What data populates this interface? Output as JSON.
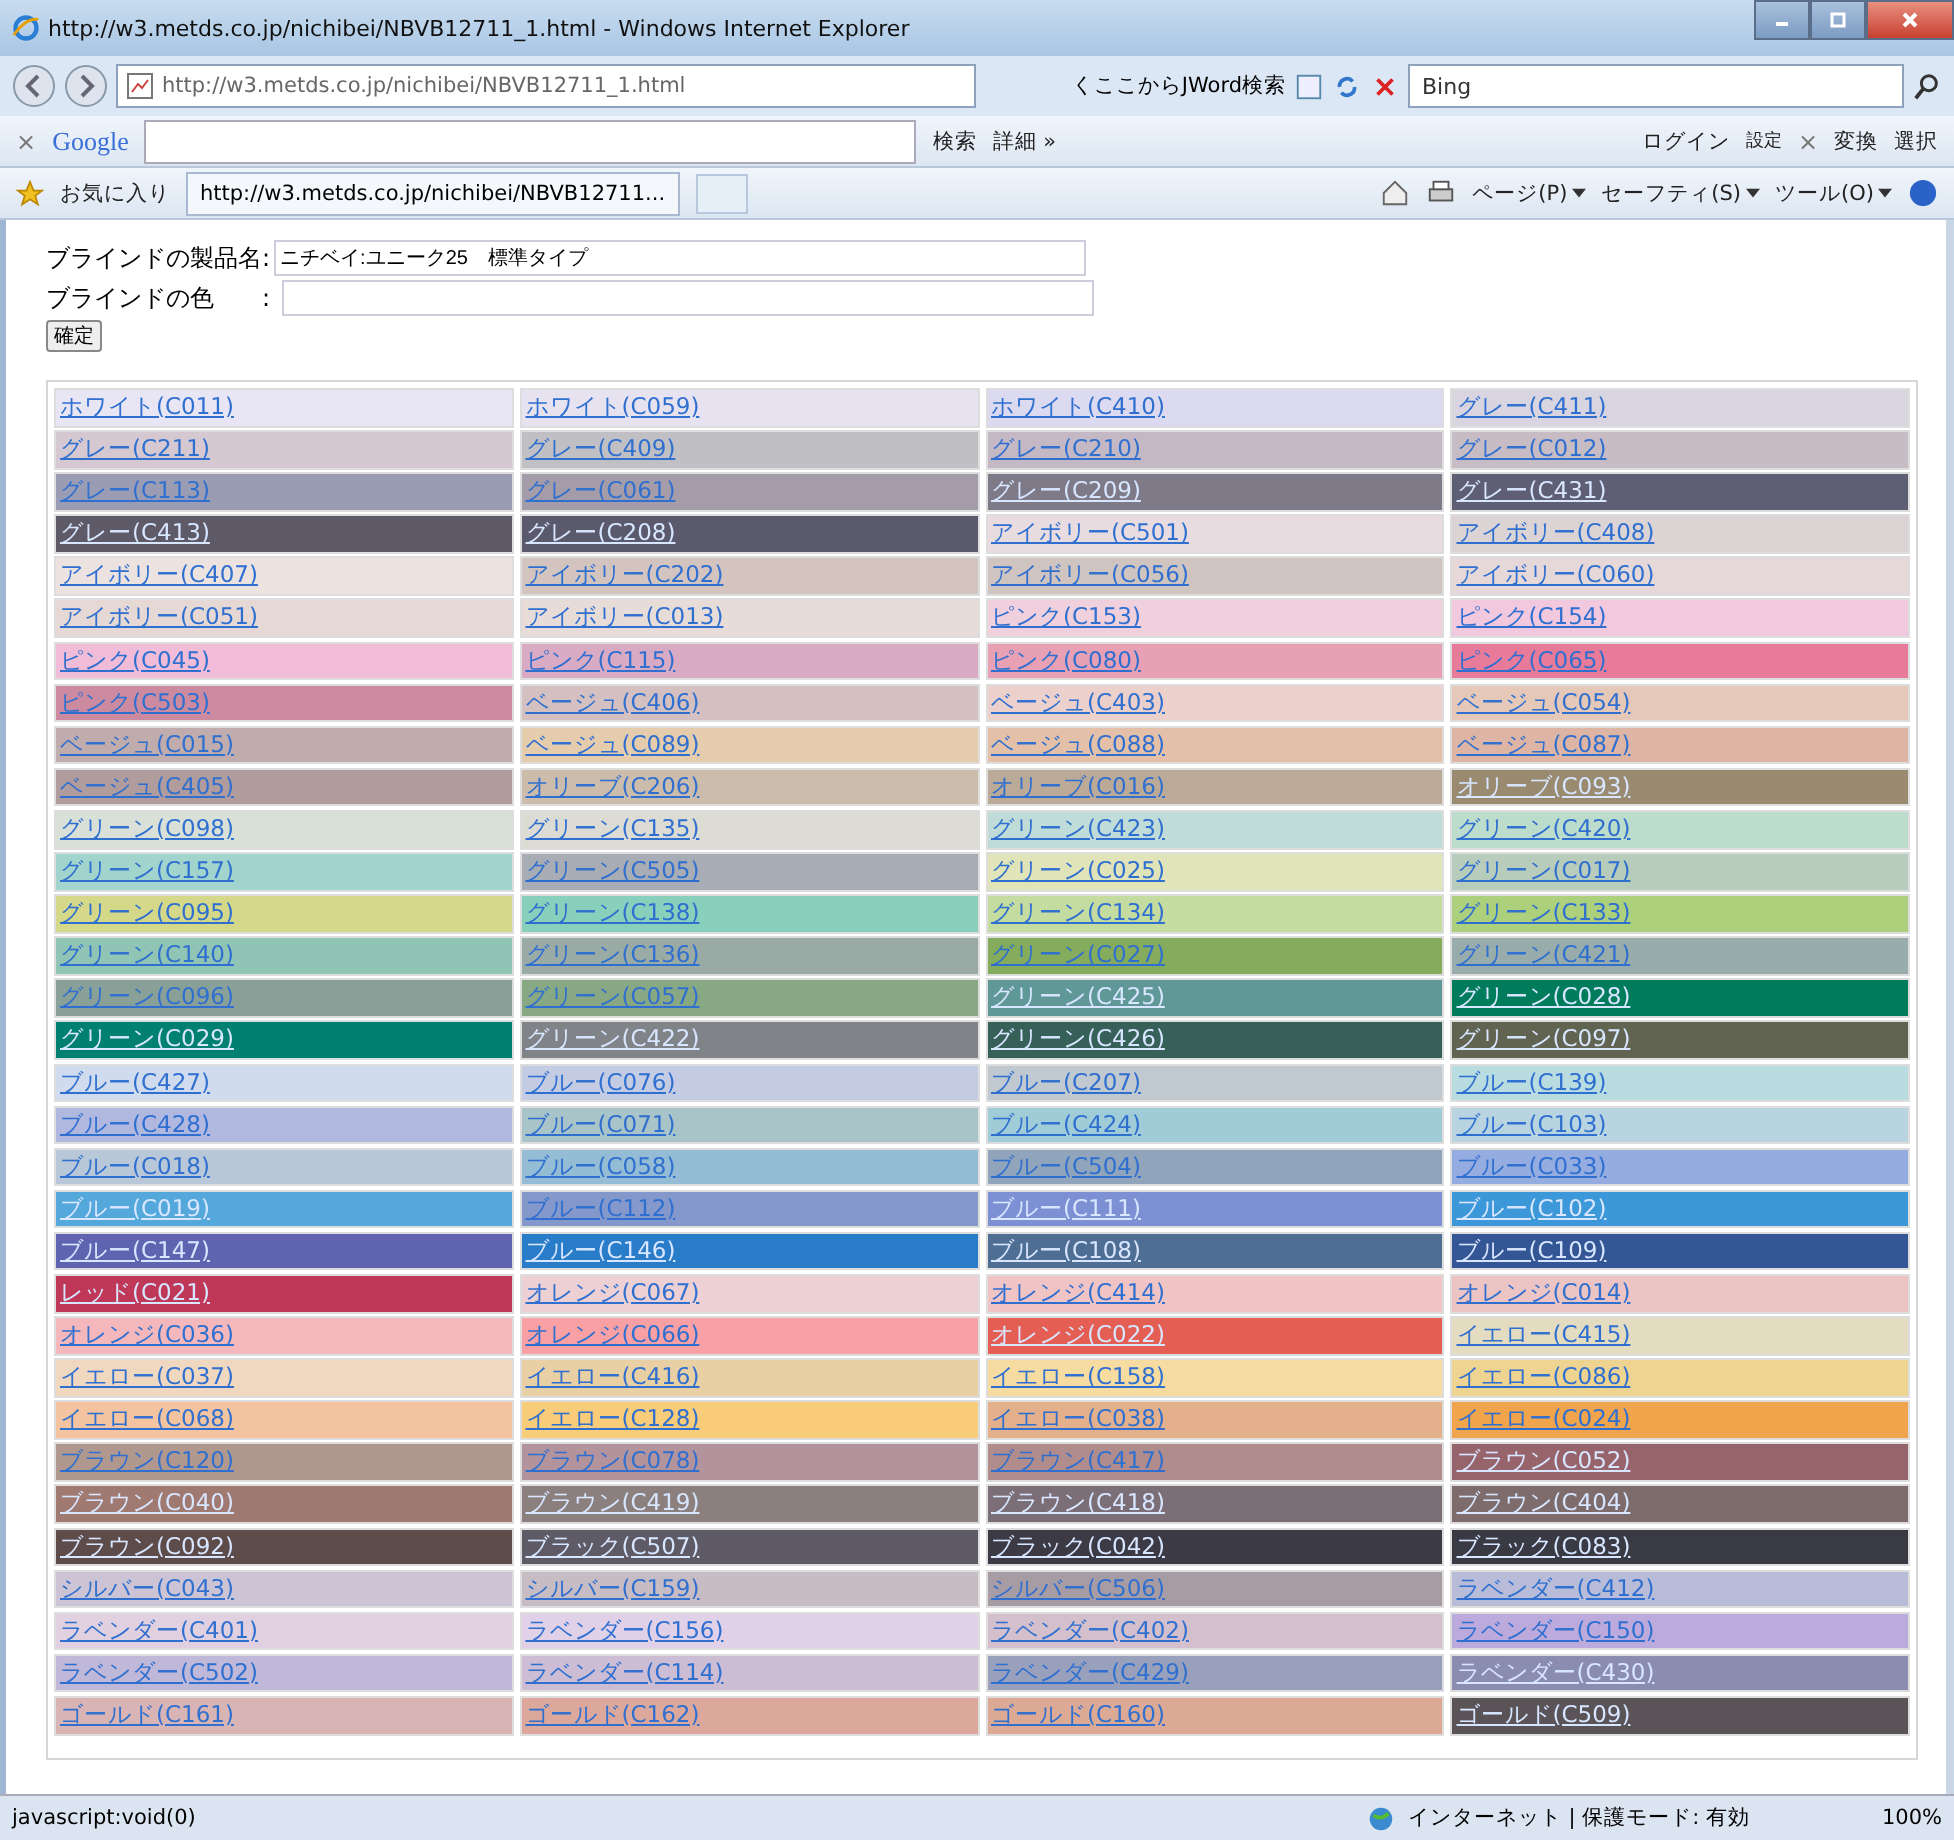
{
  "window": {
    "title": "http://w3.metds.co.jp/nichibei/NBVB12711_1.html - Windows Internet Explorer"
  },
  "address_bar": {
    "url": "http://w3.metds.co.jp/nichibei/NBVB12711_1.html",
    "search_label": "くここからJWord検索",
    "search_engine": "Bing"
  },
  "google_toolbar": {
    "close": "×",
    "logo": "Google",
    "search_button": "検索",
    "more": "詳細 »",
    "login": "ログイン",
    "settings": "設定",
    "close_right": "×",
    "convert": "変換",
    "select": "選択"
  },
  "favorites_bar": {
    "favorites": "お気に入り",
    "tab": "http://w3.metds.co.jp/nichibei/NBVB12711...",
    "menus": [
      "ページ(P)",
      "セーフティ(S)",
      "ツール(O)"
    ]
  },
  "form": {
    "fields": [
      {
        "label": "ブラインドの製品名:",
        "value": "ニチベイ:ユニーク25　標準タイプ"
      },
      {
        "label": "ブラインドの色",
        "colon": ":"
      }
    ],
    "button": "確定"
  },
  "swatches": [
    {
      "label": "ホワイト(C011)",
      "color": "#e8e6f4"
    },
    {
      "label": "ホワイト(C059)",
      "color": "#e6e2f0"
    },
    {
      "label": "ホワイト(C410)",
      "color": "#dcdaf0"
    },
    {
      "label": "グレー(C411)",
      "color": "#d8d4e0"
    },
    {
      "label": "グレー(C211)",
      "color": "#d6c8d0"
    },
    {
      "label": "グレー(C409)",
      "color": "#c0c0c4"
    },
    {
      "label": "グレー(C210)",
      "color": "#c4b8c4"
    },
    {
      "label": "グレー(C012)",
      "color": "#c8bcc4"
    },
    {
      "label": "グレー(C113)",
      "color": "#9a9cb4"
    },
    {
      "label": "グレー(C061)",
      "color": "#a49ca8"
    },
    {
      "label": "グレー(C209)",
      "color": "#7e7a88"
    },
    {
      "label": "グレー(C431)",
      "color": "#5e5e74"
    },
    {
      "label": "グレー(C413)",
      "color": "#5e5a68"
    },
    {
      "label": "グレー(C208)",
      "color": "#5a5a6c"
    },
    {
      "label": "アイボリー(C501)",
      "color": "#e8dce0"
    },
    {
      "label": "アイボリー(C408)",
      "color": "#dcd4d4"
    },
    {
      "label": "アイボリー(C407)",
      "color": "#ece2e0"
    },
    {
      "label": "アイボリー(C202)",
      "color": "#d4c4c0"
    },
    {
      "label": "アイボリー(C056)",
      "color": "#d0c4c0"
    },
    {
      "label": "アイボリー(C060)",
      "color": "#e6d8d8"
    },
    {
      "label": "アイボリー(C051)",
      "color": "#e6d8d4"
    },
    {
      "label": "アイボリー(C013)",
      "color": "#e8dcd8"
    },
    {
      "label": "ピンク(C153)",
      "color": "#f0d0dc"
    },
    {
      "label": "ピンク(C154)",
      "color": "#f2c8de"
    },
    {
      "label": "ピンク(C045)",
      "color": "#f0bcd8"
    },
    {
      "label": "ピンク(C115)",
      "color": "#d8aac4"
    },
    {
      "label": "ピンク(C080)",
      "color": "#e8a0b4"
    },
    {
      "label": "ピンク(C065)",
      "color": "#e87a9a"
    },
    {
      "label": "ピンク(C503)",
      "color": "#cc8aa0"
    },
    {
      "label": "ベージュ(C406)",
      "color": "#d4c0c0"
    },
    {
      "label": "ベージュ(C403)",
      "color": "#ecd0cc"
    },
    {
      "label": "ベージュ(C054)",
      "color": "#e6c8b8"
    },
    {
      "label": "ベージュ(C015)",
      "color": "#c0acac"
    },
    {
      "label": "ベージュ(C089)",
      "color": "#e4ccac"
    },
    {
      "label": "ベージュ(C088)",
      "color": "#e4c0a8"
    },
    {
      "label": "ベージュ(C087)",
      "color": "#deb4a4"
    },
    {
      "label": "ベージュ(C405)",
      "color": "#b09c9c"
    },
    {
      "label": "オリーブ(C206)",
      "color": "#ccbcac"
    },
    {
      "label": "オリーブ(C016)",
      "color": "#bcaa98"
    },
    {
      "label": "オリーブ(C093)",
      "color": "#9a8a70"
    },
    {
      "label": "グリーン(C098)",
      "color": "#d8e0d8"
    },
    {
      "label": "グリーン(C135)",
      "color": "#dcdcd4"
    },
    {
      "label": "グリーン(C423)",
      "color": "#c0dcd8"
    },
    {
      "label": "グリーン(C420)",
      "color": "#bcdccc"
    },
    {
      "label": "グリーン(C157)",
      "color": "#a0d4cc"
    },
    {
      "label": "グリーン(C505)",
      "color": "#a8acb4"
    },
    {
      "label": "グリーン(C025)",
      "color": "#e0e4b8"
    },
    {
      "label": "グリーン(C017)",
      "color": "#b8ccbc"
    },
    {
      "label": "グリーン(C095)",
      "color": "#d4d888"
    },
    {
      "label": "グリーン(C138)",
      "color": "#88d0bc"
    },
    {
      "label": "グリーン(C134)",
      "color": "#c4dca0"
    },
    {
      "label": "グリーン(C133)",
      "color": "#acd07c"
    },
    {
      "label": "グリーン(C140)",
      "color": "#90c4b4"
    },
    {
      "label": "グリーン(C136)",
      "color": "#9aaaa4"
    },
    {
      "label": "グリーン(C027)",
      "color": "#84ac5c"
    },
    {
      "label": "グリーン(C421)",
      "color": "#98acac"
    },
    {
      "label": "グリーン(C096)",
      "color": "#88a098"
    },
    {
      "label": "グリーン(C057)",
      "color": "#88a884"
    },
    {
      "label": "グリーン(C425)",
      "color": "#609898"
    },
    {
      "label": "グリーン(C028)",
      "color": "#007c5c"
    },
    {
      "label": "グリーン(C029)",
      "color": "#008070"
    },
    {
      "label": "グリーン(C422)",
      "color": "#808488"
    },
    {
      "label": "グリーン(C426)",
      "color": "#366058"
    },
    {
      "label": "グリーン(C097)",
      "color": "#606450"
    },
    {
      "label": "ブルー(C427)",
      "color": "#d0dcee"
    },
    {
      "label": "ブルー(C076)",
      "color": "#c4cce4"
    },
    {
      "label": "ブルー(C207)",
      "color": "#c0c8d0"
    },
    {
      "label": "ブルー(C139)",
      "color": "#b8dce0"
    },
    {
      "label": "ブルー(C428)",
      "color": "#b0b8e0"
    },
    {
      "label": "ブルー(C071)",
      "color": "#a8c4c8"
    },
    {
      "label": "ブルー(C424)",
      "color": "#a0ccd8"
    },
    {
      "label": "ブルー(C103)",
      "color": "#b8d4e0"
    },
    {
      "label": "ブルー(C018)",
      "color": "#b8c8d8"
    },
    {
      "label": "ブルー(C058)",
      "color": "#94bcd4"
    },
    {
      "label": "ブルー(C504)",
      "color": "#90a4bc"
    },
    {
      "label": "ブルー(C033)",
      "color": "#94ace0"
    },
    {
      "label": "ブルー(C019)",
      "color": "#54a8dc"
    },
    {
      "label": "ブルー(C112)",
      "color": "#8498cc"
    },
    {
      "label": "ブルー(C111)",
      "color": "#7e90d4"
    },
    {
      "label": "ブルー(C102)",
      "color": "#3c98d8"
    },
    {
      "label": "ブルー(C147)",
      "color": "#6064b0"
    },
    {
      "label": "ブルー(C146)",
      "color": "#287cc8"
    },
    {
      "label": "ブルー(C108)",
      "color": "#4e6e94"
    },
    {
      "label": "ブルー(C109)",
      "color": "#345694"
    },
    {
      "label": "レッド(C021)",
      "color": "#c03858"
    },
    {
      "label": "オレンジ(C067)",
      "color": "#ecd0d4"
    },
    {
      "label": "オレンジ(C414)",
      "color": "#f0c4c4"
    },
    {
      "label": "オレンジ(C014)",
      "color": "#ecc4c4"
    },
    {
      "label": "オレンジ(C036)",
      "color": "#f4b8bc"
    },
    {
      "label": "オレンジ(C066)",
      "color": "#f8a0a4"
    },
    {
      "label": "オレンジ(C022)",
      "color": "#e45e54"
    },
    {
      "label": "イエロー(C415)",
      "color": "#e4dcc0"
    },
    {
      "label": "イエロー(C037)",
      "color": "#f0d8c0"
    },
    {
      "label": "イエロー(C416)",
      "color": "#e8d0a4"
    },
    {
      "label": "イエロー(C158)",
      "color": "#f6dca0"
    },
    {
      "label": "イエロー(C086)",
      "color": "#eed490"
    },
    {
      "label": "イエロー(C068)",
      "color": "#f4c4a0"
    },
    {
      "label": "イエロー(C128)",
      "color": "#f8cc78"
    },
    {
      "label": "イエロー(C038)",
      "color": "#e4b08c"
    },
    {
      "label": "イエロー(C024)",
      "color": "#f0a44c"
    },
    {
      "label": "ブラウン(C120)",
      "color": "#b0988e"
    },
    {
      "label": "ブラウン(C078)",
      "color": "#b4949c"
    },
    {
      "label": "ブラウン(C417)",
      "color": "#b08c8c"
    },
    {
      "label": "ブラウン(C052)",
      "color": "#98646c"
    },
    {
      "label": "ブラウン(C040)",
      "color": "#a07a70"
    },
    {
      "label": "ブラウン(C419)",
      "color": "#8c807e"
    },
    {
      "label": "ブラウン(C418)",
      "color": "#7c6e76"
    },
    {
      "label": "ブラウン(C404)",
      "color": "#7e6c6c"
    },
    {
      "label": "ブラウン(C092)",
      "color": "#5e4c4a"
    },
    {
      "label": "ブラック(C507)",
      "color": "#5e5a66"
    },
    {
      "label": "ブラック(C042)",
      "color": "#3c3a44"
    },
    {
      "label": "ブラック(C083)",
      "color": "#3a3a44"
    },
    {
      "label": "シルバー(C043)",
      "color": "#ccc4d4"
    },
    {
      "label": "シルバー(C159)",
      "color": "#c8bcc4"
    },
    {
      "label": "シルバー(C506)",
      "color": "#a89ca4"
    },
    {
      "label": "ラベンダー(C412)",
      "color": "#b8bcd8"
    },
    {
      "label": "ラベンダー(C401)",
      "color": "#e0d0e0"
    },
    {
      "label": "ラベンダー(C156)",
      "color": "#e0d0e8"
    },
    {
      "label": "ラベンダー(C402)",
      "color": "#d4c0cc"
    },
    {
      "label": "ラベンダー(C150)",
      "color": "#bcaadc"
    },
    {
      "label": "ラベンダー(C502)",
      "color": "#c0b8d8"
    },
    {
      "label": "ラベンダー(C114)",
      "color": "#ccbcd4"
    },
    {
      "label": "ラベンダー(C429)",
      "color": "#98a0bc"
    },
    {
      "label": "ラベンダー(C430)",
      "color": "#8a8cb0"
    },
    {
      "label": "ゴールド(C161)",
      "color": "#d8b4b4"
    },
    {
      "label": "ゴールド(C162)",
      "color": "#dca89c"
    },
    {
      "label": "ゴールド(C160)",
      "color": "#dcaa94"
    },
    {
      "label": "ゴールド(C509)",
      "color": "#5a5458"
    }
  ],
  "status_bar": {
    "text": "javascript:void(0)",
    "zone": "インターネット | 保護モード: 有効",
    "zoom": "100%"
  }
}
